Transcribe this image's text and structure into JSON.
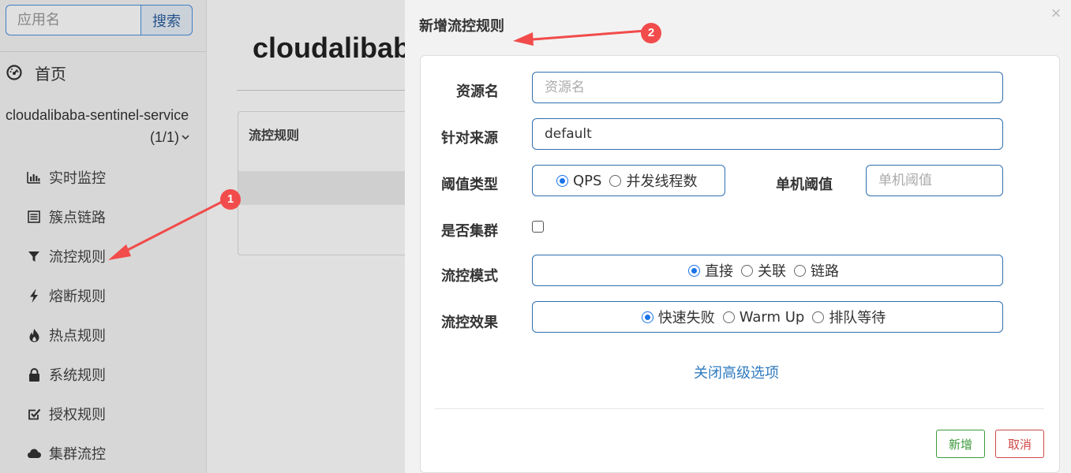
{
  "sidebar": {
    "search_placeholder": "应用名",
    "search_button": "搜索",
    "home_label": "首页",
    "app_name": "cloudalibaba-sentinel-service",
    "app_count": "(1/1)",
    "items": [
      {
        "label": "实时监控",
        "icon": "bar-chart-icon"
      },
      {
        "label": "簇点链路",
        "icon": "list-icon"
      },
      {
        "label": "流控规则",
        "icon": "filter-icon"
      },
      {
        "label": "熔断规则",
        "icon": "lightning-icon"
      },
      {
        "label": "热点规则",
        "icon": "fire-icon"
      },
      {
        "label": "系统规则",
        "icon": "lock-icon"
      },
      {
        "label": "授权规则",
        "icon": "check-square-icon"
      },
      {
        "label": "集群流控",
        "icon": "cloud-icon"
      }
    ]
  },
  "main": {
    "title": "cloudalibaba",
    "panel_header": "流控规则"
  },
  "modal": {
    "title": "新增流控规则",
    "close": "×",
    "resource_label": "资源名",
    "resource_placeholder": "资源名",
    "source_label": "针对来源",
    "source_value": "default",
    "threshold_type_label": "阈值类型",
    "threshold_type_options": [
      "QPS",
      "并发线程数"
    ],
    "threshold_type_selected": "QPS",
    "single_threshold_label": "单机阈值",
    "single_threshold_placeholder": "单机阈值",
    "cluster_label": "是否集群",
    "cluster_checked": false,
    "mode_label": "流控模式",
    "mode_options": [
      "直接",
      "关联",
      "链路"
    ],
    "mode_selected": "直接",
    "effect_label": "流控效果",
    "effect_options": [
      "快速失败",
      "Warm Up",
      "排队等待"
    ],
    "effect_selected": "快速失败",
    "advanced_link": "关闭高级选项",
    "add_button": "新增",
    "cancel_button": "取消"
  },
  "annotations": {
    "badge_1": "1",
    "badge_2": "2",
    "arrow_color": "#f24b4b"
  }
}
